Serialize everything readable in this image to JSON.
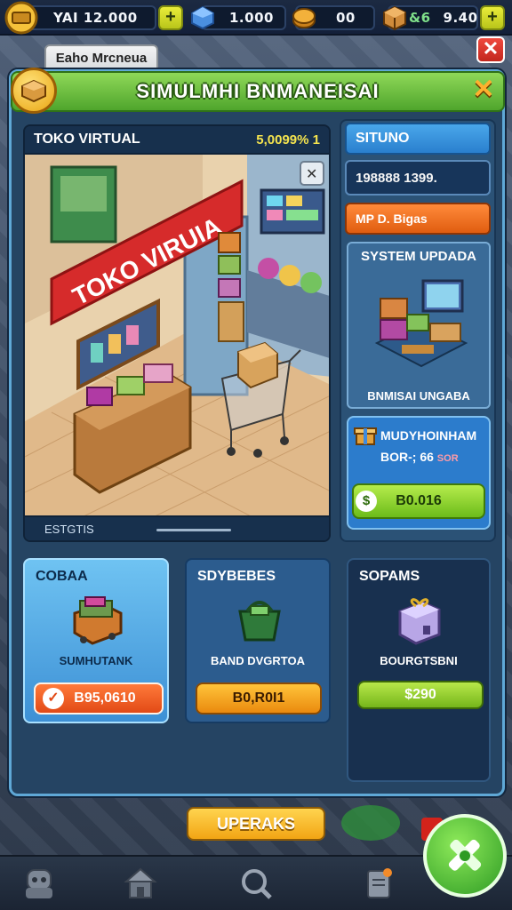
{
  "topbar": {
    "resource1": {
      "icon": "cash-icon",
      "value": "YAI 12.000"
    },
    "resource2": {
      "icon": "blue-gem-icon",
      "value": "1.000"
    },
    "resource3": {
      "icon": "gold-coin-icon",
      "value": "00"
    },
    "resource4": {
      "icon": "box-icon",
      "value": "9.40",
      "prefix": "&6"
    }
  },
  "window_tab": "Eaho Mrcneua",
  "header": {
    "title": "SIMULMHI BNMANEISAI"
  },
  "store": {
    "name": "TOKO VIRTUAL",
    "rate": "5,0099%  1",
    "sign": "TOKO VIRUIA",
    "footer": "ESTGTIS"
  },
  "right": {
    "status_label": "SITUNO",
    "stat_value": "198888 1399.",
    "promo_label": "MP D. Bigas",
    "system_card": {
      "title": "SYSTEM UPDADA",
      "caption": "BNMISAI UNGABA"
    },
    "upgrade_card": {
      "line1": "MUDYHOINHAM",
      "line2": "BOR-; 66",
      "line2_small": "SOR",
      "price": "B0.016",
      "coin": "$"
    }
  },
  "items": [
    {
      "label": "COBAA",
      "caption": "SUMHUTANK",
      "price": "B95,0610"
    },
    {
      "label": "SDYBEBES",
      "caption": "BAND DVGRTOA",
      "price": "B0,R0I1"
    },
    {
      "label": "SOPAMS",
      "caption": "BOURGTSBNI",
      "price": "$290"
    }
  ],
  "bottom": {
    "upgrade_label": "UPERAKS"
  },
  "colors": {
    "accent_green": "#4fa52c",
    "panel_blue": "#254463",
    "gold": "#f2a514"
  }
}
